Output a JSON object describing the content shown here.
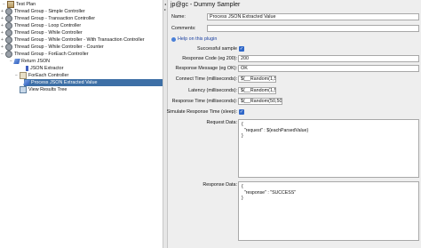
{
  "tree": {
    "items": [
      {
        "label": "Test Plan",
        "icon": "test-plan-icon",
        "toggle": "−"
      },
      {
        "label": "Thread Group - Simple Controller",
        "icon": "thread-group-icon",
        "toggle": "+"
      },
      {
        "label": "Thread Group - Transaction Controller",
        "icon": "thread-group-icon",
        "toggle": "+"
      },
      {
        "label": "Thread Group - Loop Controller",
        "icon": "thread-group-icon",
        "toggle": "+"
      },
      {
        "label": "Thread Group - While Controller",
        "icon": "thread-group-icon",
        "toggle": "+"
      },
      {
        "label": "Thread Group - While Controller - With Transaction Controller",
        "icon": "thread-group-icon",
        "toggle": "+"
      },
      {
        "label": "Thread Group - While Controller - Counter",
        "icon": "thread-group-icon",
        "toggle": "+"
      },
      {
        "label": "Thread Group - ForEach Controller",
        "icon": "thread-group-icon",
        "toggle": "−"
      },
      {
        "label": "Return JSON",
        "icon": "sampler-icon",
        "toggle": "−"
      },
      {
        "label": "JSON Extractor",
        "icon": "extractor-icon",
        "toggle": ""
      },
      {
        "label": "ForEach Controller",
        "icon": "controller-icon",
        "toggle": "−"
      },
      {
        "label": "Process JSON Extracted Value",
        "icon": "sampler-icon",
        "toggle": ""
      },
      {
        "label": "View Results Tree",
        "icon": "listener-icon",
        "toggle": ""
      }
    ],
    "selected_index": 11
  },
  "panel": {
    "title": "jp@gc - Dummy Sampler",
    "name_label": "Name:",
    "name_value": "Process JSON Extracted Value",
    "comments_label": "Comments:",
    "comments_value": "",
    "help_link": "Help on this plugin",
    "successful_label": "Successful sample",
    "successful_checked": true,
    "response_code_label": "Response Code (eg 200):",
    "response_code_value": "200",
    "response_message_label": "Response Message (eg OK):",
    "response_message_value": "OK",
    "connect_time_label": "Connect Time (milliseconds):",
    "connect_time_value": "${__Random(1,5)}",
    "latency_label": "Latency (milliseconds):",
    "latency_value": "${__Random(1,50)}",
    "response_time_label": "Response Time (milliseconds):",
    "response_time_value": "${__Random(50,500)}",
    "simulate_label": "Simulate Response Time (sleep):",
    "simulate_checked": true,
    "request_data_label": "Request Data:",
    "request_data_value": "{\n  \"request\" : ${eachParsedValue}\n}",
    "response_data_label": "Response Data:",
    "response_data_value": "{\n  \"response\" : \"SUCCESS\"\n}"
  },
  "colors": {
    "selection": "#3d6fa6",
    "checkbox": "#2f67c8",
    "panel_bg": "#eeeeee"
  }
}
